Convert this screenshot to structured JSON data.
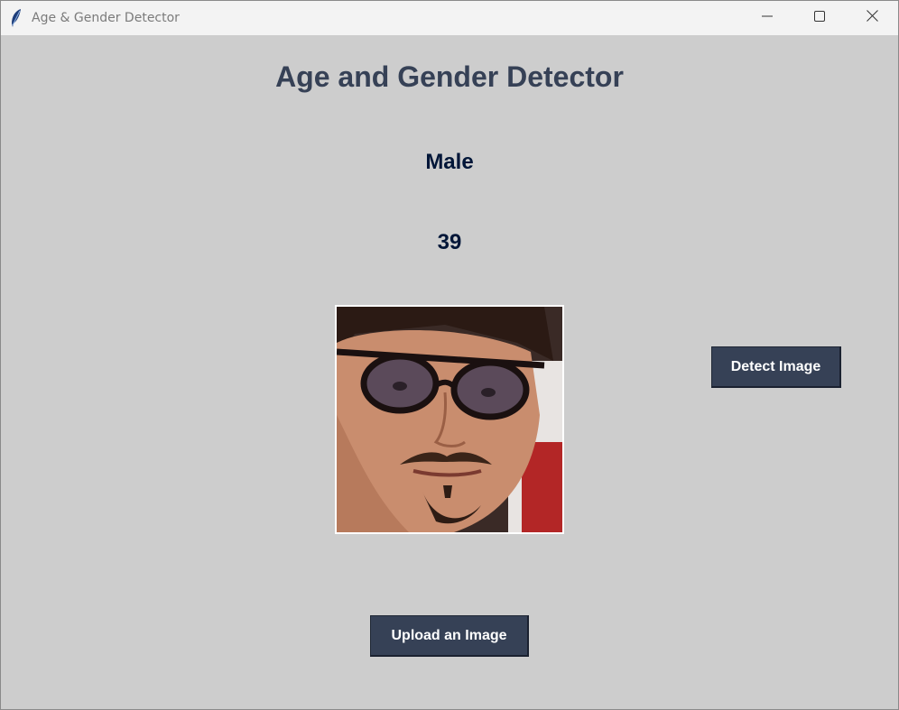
{
  "window": {
    "title": "Age & Gender Detector",
    "app_icon": "feather-icon",
    "controls": [
      "minimize-icon",
      "maximize-icon",
      "close-icon"
    ]
  },
  "main": {
    "heading": "Age and Gender Detector",
    "gender_result": "Male",
    "age_result": "39",
    "image_alt": "uploaded face photo"
  },
  "buttons": {
    "detect_label": "Detect Image",
    "upload_label": "Upload an Image"
  },
  "colors": {
    "background": "#cdcdcd",
    "heading": "#364156",
    "result_text": "#011638",
    "button_bg": "#364156",
    "button_text": "#ffffff"
  }
}
